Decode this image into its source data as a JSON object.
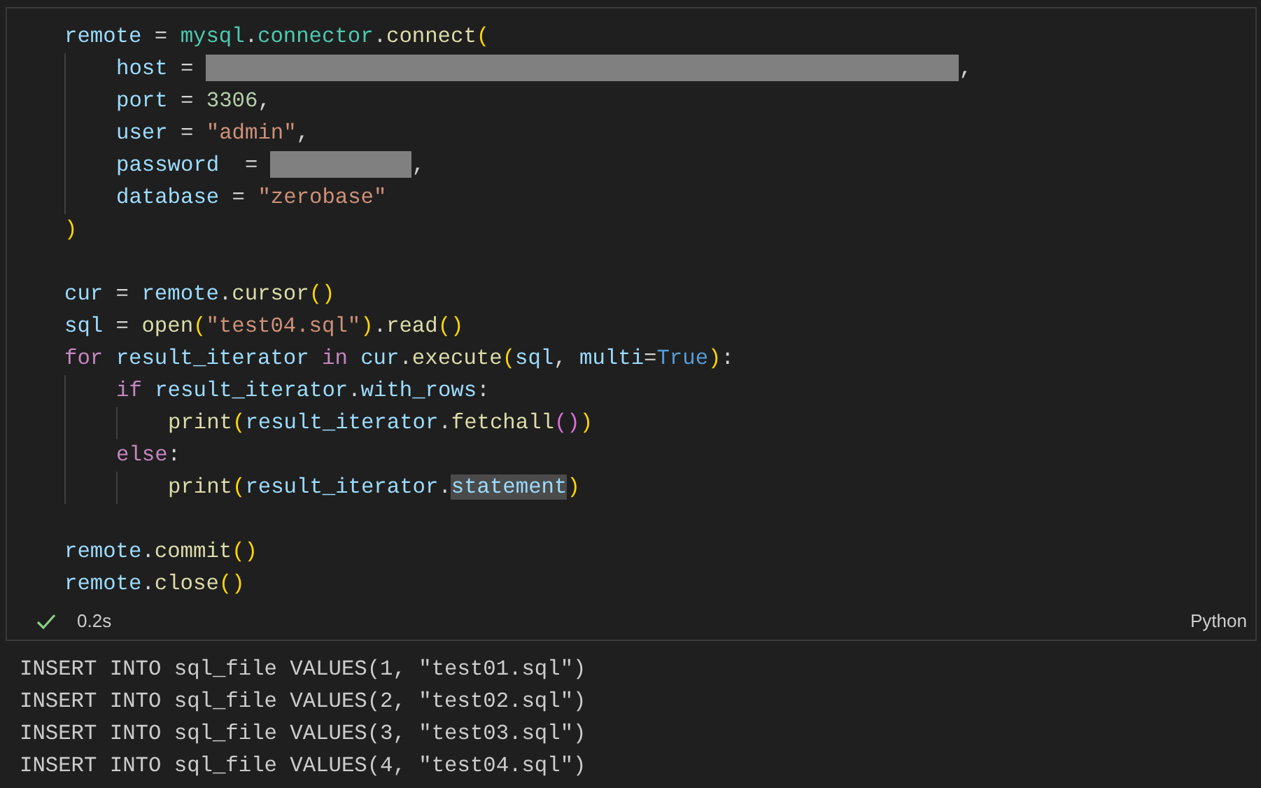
{
  "cell": {
    "lines": [
      {
        "kind": "code",
        "tokens": [
          {
            "kind": "var",
            "text": "remote"
          },
          {
            "kind": "op",
            "text": " = "
          },
          {
            "kind": "module",
            "text": "mysql"
          },
          {
            "kind": "op",
            "text": "."
          },
          {
            "kind": "module",
            "text": "connector"
          },
          {
            "kind": "op",
            "text": "."
          },
          {
            "kind": "fn",
            "text": "connect"
          },
          {
            "kind": "paren1",
            "text": "("
          }
        ],
        "children": [
          {
            "kind": "code",
            "tokens": [
              {
                "kind": "var",
                "text": "host"
              },
              {
                "kind": "op",
                "text": " = "
              },
              {
                "kind": "redacted_long"
              },
              {
                "kind": "op",
                "text": ","
              }
            ]
          },
          {
            "kind": "code",
            "tokens": [
              {
                "kind": "var",
                "text": "port"
              },
              {
                "kind": "op",
                "text": " = "
              },
              {
                "kind": "num",
                "text": "3306"
              },
              {
                "kind": "op",
                "text": ","
              }
            ]
          },
          {
            "kind": "code",
            "tokens": [
              {
                "kind": "var",
                "text": "user"
              },
              {
                "kind": "op",
                "text": " = "
              },
              {
                "kind": "str",
                "text": "\"admin\""
              },
              {
                "kind": "op",
                "text": ","
              }
            ]
          },
          {
            "kind": "code",
            "tokens": [
              {
                "kind": "var",
                "text": "password"
              },
              {
                "kind": "op",
                "text": "  = "
              },
              {
                "kind": "redacted_short"
              },
              {
                "kind": "op",
                "text": ","
              }
            ]
          },
          {
            "kind": "code",
            "tokens": [
              {
                "kind": "var",
                "text": "database"
              },
              {
                "kind": "op",
                "text": " = "
              },
              {
                "kind": "str",
                "text": "\"zerobase\""
              }
            ]
          }
        ]
      },
      {
        "kind": "code",
        "tokens": [
          {
            "kind": "paren1",
            "text": ")"
          }
        ]
      },
      {
        "kind": "blank"
      },
      {
        "kind": "code",
        "tokens": [
          {
            "kind": "var",
            "text": "cur"
          },
          {
            "kind": "op",
            "text": " = "
          },
          {
            "kind": "var",
            "text": "remote"
          },
          {
            "kind": "op",
            "text": "."
          },
          {
            "kind": "fn",
            "text": "cursor"
          },
          {
            "kind": "paren1",
            "text": "()"
          }
        ]
      },
      {
        "kind": "code",
        "tokens": [
          {
            "kind": "var",
            "text": "sql"
          },
          {
            "kind": "op",
            "text": " = "
          },
          {
            "kind": "fn",
            "text": "open"
          },
          {
            "kind": "paren1",
            "text": "("
          },
          {
            "kind": "str",
            "text": "\"test04.sql\""
          },
          {
            "kind": "paren1",
            "text": ")"
          },
          {
            "kind": "op",
            "text": "."
          },
          {
            "kind": "fn",
            "text": "read"
          },
          {
            "kind": "paren1",
            "text": "()"
          }
        ]
      },
      {
        "kind": "code",
        "tokens": [
          {
            "kind": "kw",
            "text": "for"
          },
          {
            "kind": "space"
          },
          {
            "kind": "var",
            "text": "result_iterator"
          },
          {
            "kind": "space"
          },
          {
            "kind": "kw",
            "text": "in"
          },
          {
            "kind": "space"
          },
          {
            "kind": "var",
            "text": "cur"
          },
          {
            "kind": "op",
            "text": "."
          },
          {
            "kind": "fn",
            "text": "execute"
          },
          {
            "kind": "paren1",
            "text": "("
          },
          {
            "kind": "var",
            "text": "sql"
          },
          {
            "kind": "op",
            "text": ", "
          },
          {
            "kind": "var",
            "text": "multi"
          },
          {
            "kind": "op",
            "text": "="
          },
          {
            "kind": "const",
            "text": "True"
          },
          {
            "kind": "paren1",
            "text": ")"
          },
          {
            "kind": "op",
            "text": ":"
          }
        ],
        "children": [
          {
            "kind": "code",
            "tokens": [
              {
                "kind": "kw",
                "text": "if"
              },
              {
                "kind": "space"
              },
              {
                "kind": "var",
                "text": "result_iterator"
              },
              {
                "kind": "op",
                "text": "."
              },
              {
                "kind": "var",
                "text": "with_rows"
              },
              {
                "kind": "op",
                "text": ":"
              }
            ],
            "children": [
              {
                "kind": "code",
                "tokens": [
                  {
                    "kind": "fn",
                    "text": "print"
                  },
                  {
                    "kind": "paren1",
                    "text": "("
                  },
                  {
                    "kind": "var",
                    "text": "result_iterator"
                  },
                  {
                    "kind": "op",
                    "text": "."
                  },
                  {
                    "kind": "fn",
                    "text": "fetchall"
                  },
                  {
                    "kind": "paren2",
                    "text": "()"
                  },
                  {
                    "kind": "paren1",
                    "text": ")"
                  }
                ]
              }
            ]
          },
          {
            "kind": "code",
            "tokens": [
              {
                "kind": "kw",
                "text": "else"
              },
              {
                "kind": "op",
                "text": ":"
              }
            ],
            "children": [
              {
                "kind": "code",
                "tokens": [
                  {
                    "kind": "fn",
                    "text": "print"
                  },
                  {
                    "kind": "paren1",
                    "text": "("
                  },
                  {
                    "kind": "var",
                    "text": "result_iterator"
                  },
                  {
                    "kind": "op",
                    "text": "."
                  },
                  {
                    "kind": "var_highlighted",
                    "text": "statement"
                  },
                  {
                    "kind": "paren1",
                    "text": ")"
                  }
                ]
              }
            ]
          }
        ]
      },
      {
        "kind": "blank"
      },
      {
        "kind": "code",
        "tokens": [
          {
            "kind": "var",
            "text": "remote"
          },
          {
            "kind": "op",
            "text": "."
          },
          {
            "kind": "fn",
            "text": "commit"
          },
          {
            "kind": "paren1",
            "text": "()"
          }
        ]
      },
      {
        "kind": "code",
        "tokens": [
          {
            "kind": "var",
            "text": "remote"
          },
          {
            "kind": "op",
            "text": "."
          },
          {
            "kind": "fn",
            "text": "close"
          },
          {
            "kind": "paren1",
            "text": "()"
          }
        ]
      }
    ],
    "status": {
      "succeeded": true,
      "duration": "0.2s",
      "language": "Python"
    }
  },
  "output": [
    "INSERT INTO sql_file VALUES(1, \"test01.sql\")",
    "INSERT INTO sql_file VALUES(2, \"test02.sql\")",
    "INSERT INTO sql_file VALUES(3, \"test03.sql\")",
    "INSERT INTO sql_file VALUES(4, \"test04.sql\")"
  ]
}
